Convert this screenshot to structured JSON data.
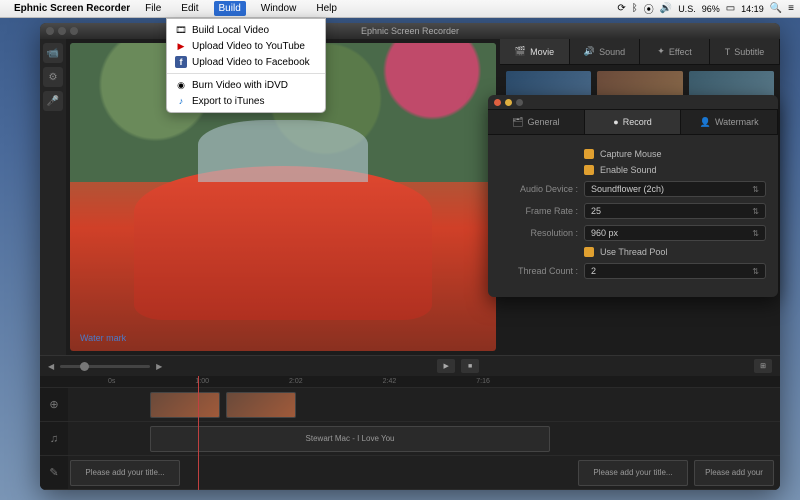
{
  "menubar": {
    "app_name": "Ephnic Screen Recorder",
    "items": [
      "File",
      "Edit",
      "Build",
      "Window",
      "Help"
    ],
    "active_index": 2,
    "status": {
      "flag": "U.S.",
      "battery": "96%",
      "time": "14:19"
    }
  },
  "dropdown": {
    "items": [
      {
        "icon": "film",
        "label": "Build Local Video"
      },
      {
        "icon": "yt",
        "label": "Upload Video to YouTube"
      },
      {
        "icon": "fb",
        "label": "Upload Video to Facebook"
      },
      {
        "sep": true
      },
      {
        "icon": "disc",
        "label": "Burn Video with iDVD"
      },
      {
        "icon": "itunes",
        "label": "Export to iTunes"
      }
    ]
  },
  "window": {
    "title": "Ephnic Screen Recorder"
  },
  "preview": {
    "watermark": "Water mark"
  },
  "right_tabs": [
    {
      "icon": "film",
      "label": "Movie",
      "active": true
    },
    {
      "icon": "sound",
      "label": "Sound"
    },
    {
      "icon": "fx",
      "label": "Effect"
    },
    {
      "icon": "T",
      "label": "Subtitle"
    }
  ],
  "settings": {
    "tabs": [
      {
        "icon": "gear",
        "label": "General"
      },
      {
        "icon": "rec",
        "label": "Record",
        "active": true
      },
      {
        "icon": "wm",
        "label": "Watermark"
      }
    ],
    "capture_mouse_label": "Capture Mouse",
    "enable_sound_label": "Enable Sound",
    "audio_device_label": "Audio Device :",
    "audio_device_value": "Soundflower (2ch)",
    "frame_rate_label": "Frame Rate :",
    "frame_rate_value": "25",
    "resolution_label": "Resolution :",
    "resolution_value": "960 px",
    "thread_pool_label": "Use Thread Pool",
    "thread_count_label": "Thread Count :",
    "thread_count_value": "2"
  },
  "timeline": {
    "ruler": [
      "0s",
      "1:00",
      "2:02",
      "2:42",
      "7:16"
    ],
    "audio_clip": "Stewart Mac - I Love You",
    "title_placeholder": "Please add your title...",
    "title_placeholder2": "Please add your title...",
    "title_placeholder3": "Please add your"
  }
}
